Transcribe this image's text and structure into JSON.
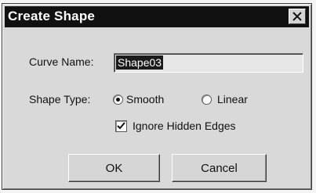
{
  "dialog": {
    "title": "Create Shape",
    "close_icon": "close-icon"
  },
  "curve_name": {
    "label": "Curve Name:",
    "value": "Shape03"
  },
  "shape_type": {
    "label": "Shape Type:",
    "options": [
      {
        "label": "Smooth",
        "selected": true
      },
      {
        "label": "Linear",
        "selected": false
      }
    ]
  },
  "ignore_hidden_edges": {
    "label": "Ignore Hidden Edges",
    "checked": true
  },
  "buttons": {
    "ok": "OK",
    "cancel": "Cancel"
  }
}
